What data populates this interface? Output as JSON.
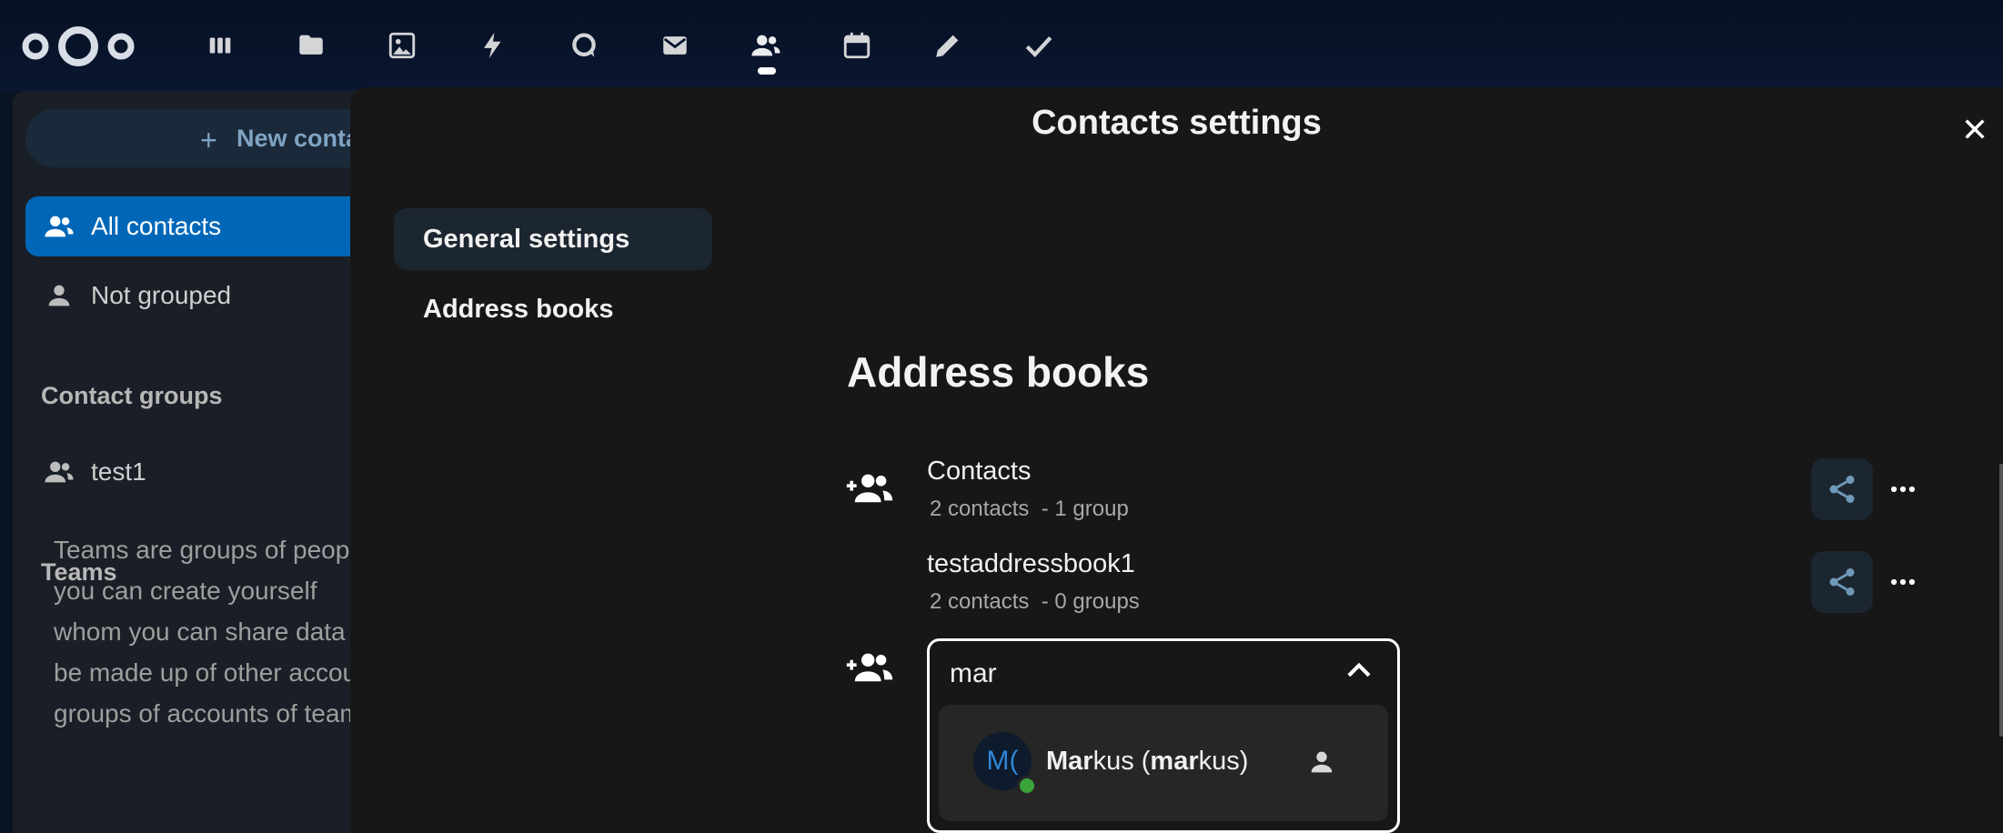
{
  "topbar": {
    "apps": [
      {
        "name": "dashboard",
        "icon": "dashboard-icon"
      },
      {
        "name": "files",
        "icon": "folder-icon"
      },
      {
        "name": "photos",
        "icon": "image-icon"
      },
      {
        "name": "activity",
        "icon": "lightning-icon"
      },
      {
        "name": "talk",
        "icon": "talk-icon"
      },
      {
        "name": "mail",
        "icon": "mail-icon"
      },
      {
        "name": "contacts",
        "icon": "contacts-icon"
      },
      {
        "name": "calendar",
        "icon": "calendar-icon"
      },
      {
        "name": "notes",
        "icon": "pencil-icon"
      },
      {
        "name": "tasks",
        "icon": "checkmark-icon"
      }
    ],
    "active_app": "contacts"
  },
  "sidebar": {
    "new_contact_label": "New contact",
    "items": [
      {
        "label": "All contacts",
        "icon": "group-icon",
        "active": true
      },
      {
        "label": "Not grouped",
        "icon": "person-icon",
        "active": false
      }
    ],
    "contact_groups_title": "Contact groups",
    "groups": [
      {
        "label": "test1",
        "icon": "group-icon"
      }
    ],
    "teams_title": "Teams",
    "teams_description_lines": [
      "Teams are groups of people",
      "you can create yourself",
      "whom you can share data",
      "be made up of other accounts",
      "groups of accounts of teams"
    ]
  },
  "modal": {
    "title": "Contacts settings",
    "nav": [
      {
        "label": "General settings",
        "active": true
      },
      {
        "label": "Address books",
        "active": false
      }
    ],
    "address_books_heading": "Address books",
    "books": [
      {
        "name": "Contacts",
        "meta": "2 contacts  - 1 group",
        "shared_icon": true
      },
      {
        "name": "testaddressbook1",
        "meta": "2 contacts  - 0 groups",
        "shared_icon": false
      }
    ],
    "search": {
      "value": "mar",
      "placeholder": ""
    },
    "result": {
      "avatar_initials": "M(",
      "label_bold_1": "Mar",
      "label_rest_1": "kus (",
      "label_bold_2": "mar",
      "label_rest_2": "kus)",
      "status": "online"
    }
  },
  "colors": {
    "accent": "#0067b8",
    "online": "#3aa43a"
  }
}
